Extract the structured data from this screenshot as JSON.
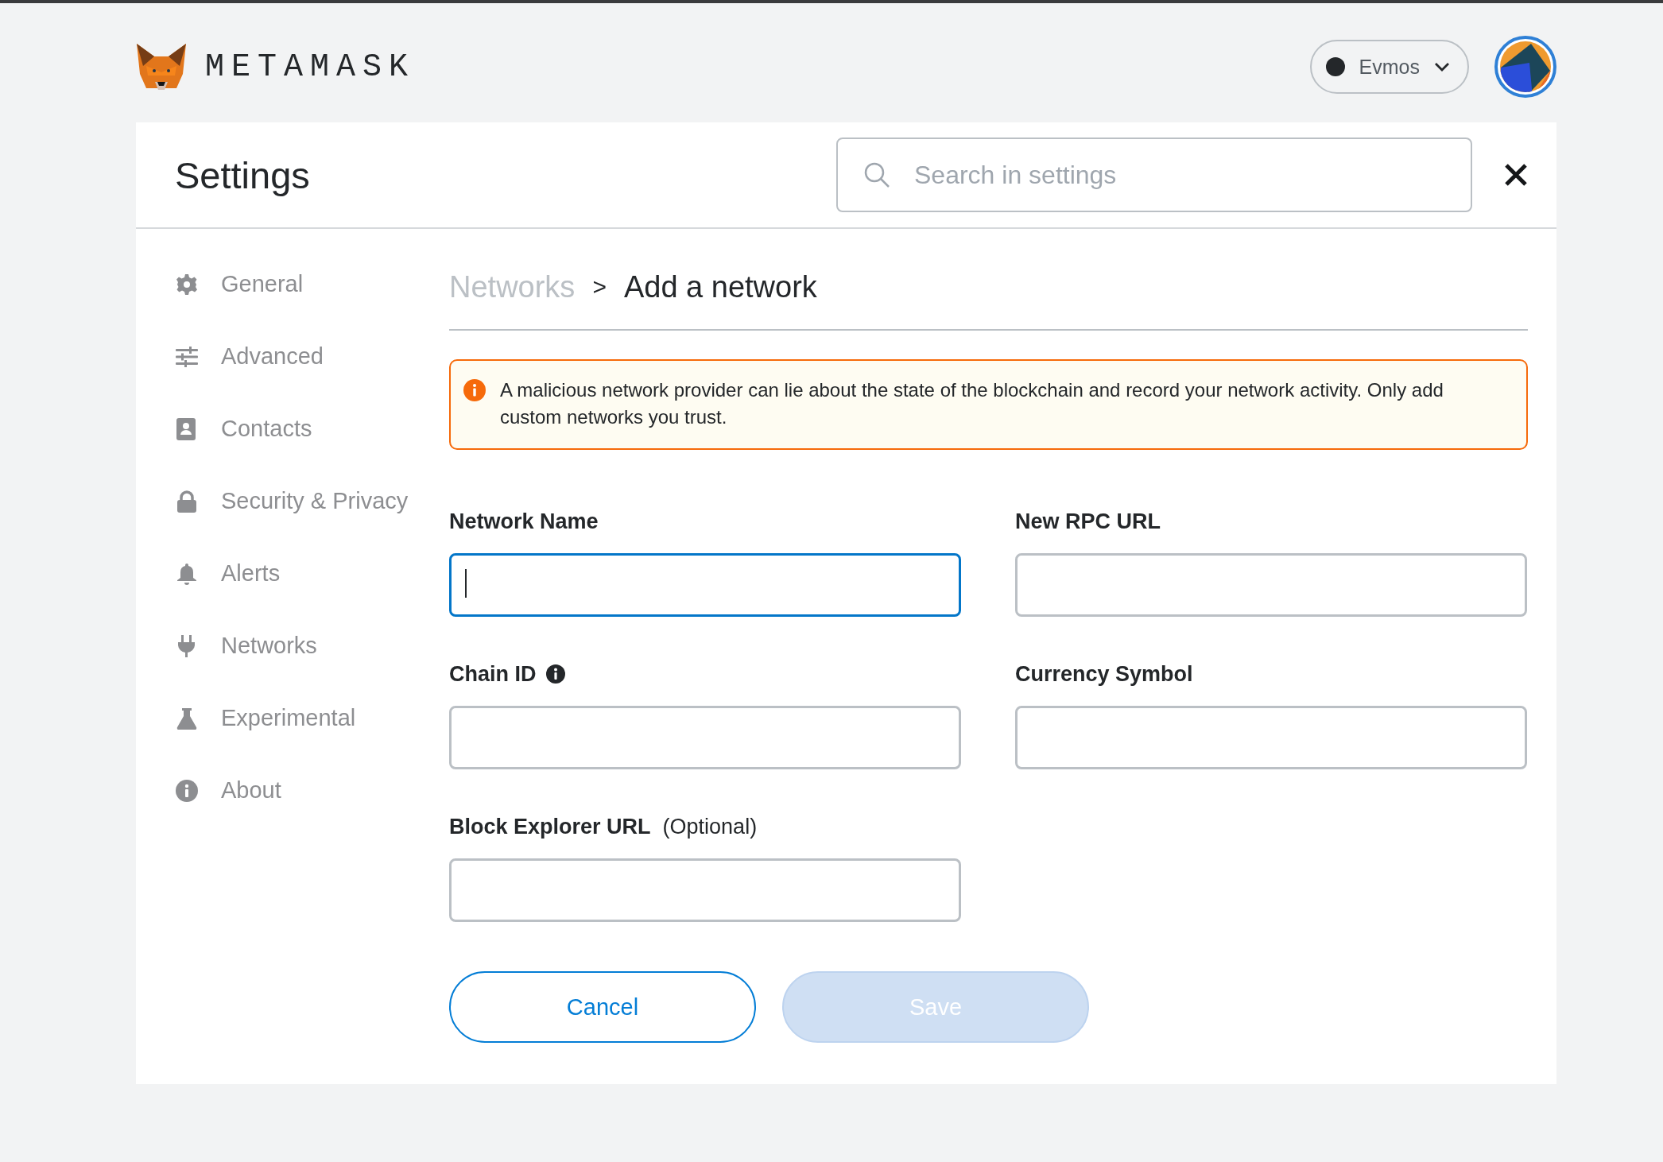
{
  "header": {
    "brand": "METAMASK",
    "network": {
      "name": "Evmos"
    }
  },
  "settings": {
    "title": "Settings",
    "search": {
      "placeholder": "Search in settings"
    }
  },
  "sidebar": {
    "items": [
      {
        "kind": "gear",
        "label": "General",
        "selected": false
      },
      {
        "kind": "sliders",
        "label": "Advanced",
        "selected": false
      },
      {
        "kind": "contacts",
        "label": "Contacts",
        "selected": false
      },
      {
        "kind": "lock",
        "label": "Security & Privacy",
        "selected": false
      },
      {
        "kind": "bell",
        "label": "Alerts",
        "selected": false
      },
      {
        "kind": "plug",
        "label": "Networks",
        "selected": false
      },
      {
        "kind": "flask",
        "label": "Experimental",
        "selected": false
      },
      {
        "kind": "info",
        "label": "About",
        "selected": false
      }
    ]
  },
  "breadcrumb": {
    "parent": "Networks",
    "separator": ">",
    "current": "Add a network"
  },
  "warning": "A malicious network provider can lie about the state of the blockchain and record your network activity. Only add custom networks you trust.",
  "form": {
    "fields": [
      {
        "label": "Network Name",
        "focused": true,
        "info": false
      },
      {
        "label": "New RPC URL",
        "focused": false,
        "info": false
      },
      {
        "label": "Chain ID",
        "focused": false,
        "info": true
      },
      {
        "label": "Currency Symbol",
        "focused": false,
        "info": false
      },
      {
        "label": "Block Explorer URL",
        "hint": "(Optional)",
        "focused": false,
        "info": false
      }
    ]
  },
  "buttons": [
    {
      "kind": "secondary",
      "label": "Cancel",
      "disabled": false
    },
    {
      "kind": "primary",
      "label": "Save",
      "disabled": true
    }
  ]
}
